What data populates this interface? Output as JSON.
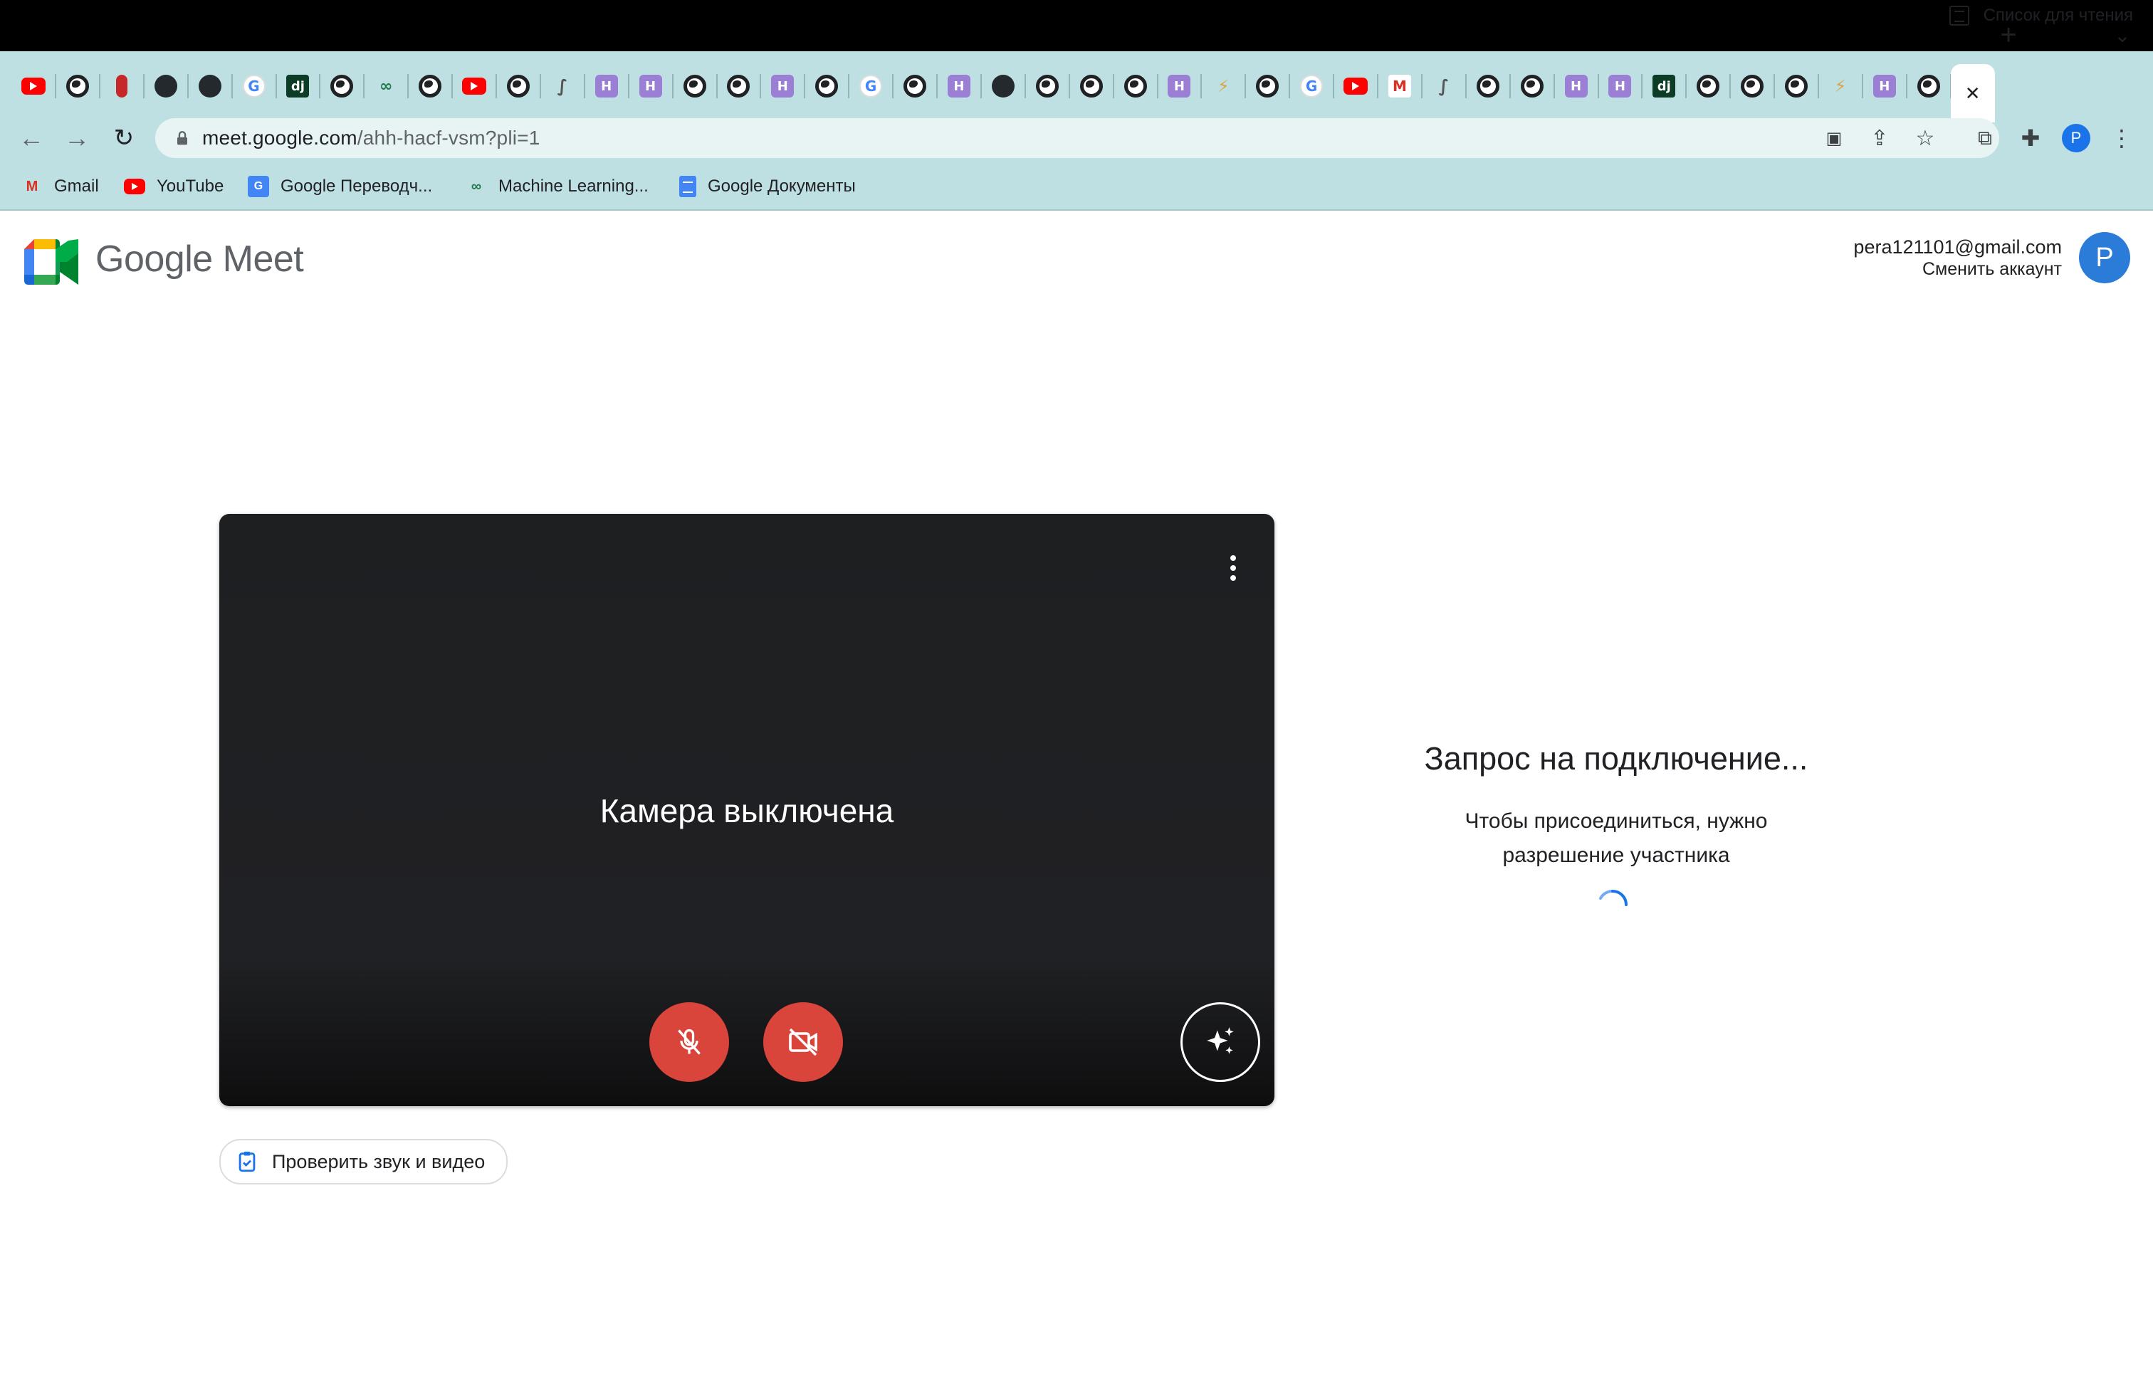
{
  "browser": {
    "tabs": [
      {
        "icon": "youtube-icon",
        "kind": "yt"
      },
      {
        "icon": "globe-icon",
        "kind": "globe"
      },
      {
        "icon": "red-dot-icon",
        "kind": "dot"
      },
      {
        "icon": "github-icon",
        "kind": "gh"
      },
      {
        "icon": "github-icon",
        "kind": "gh"
      },
      {
        "icon": "google-icon",
        "kind": "goog"
      },
      {
        "icon": "django-icon",
        "kind": "dj"
      },
      {
        "icon": "globe-icon",
        "kind": "globe"
      },
      {
        "icon": "machine-learning-icon",
        "kind": "ml"
      },
      {
        "icon": "globe-icon",
        "kind": "globe"
      },
      {
        "icon": "youtube-icon",
        "kind": "yt"
      },
      {
        "icon": "globe-icon",
        "kind": "globe"
      },
      {
        "icon": "flask-icon",
        "kind": "fl"
      },
      {
        "icon": "hexlet-icon",
        "kind": "hx"
      },
      {
        "icon": "hexlet-icon",
        "kind": "hx"
      },
      {
        "icon": "globe-icon",
        "kind": "globe"
      },
      {
        "icon": "globe-icon",
        "kind": "globe"
      },
      {
        "icon": "hexlet-icon",
        "kind": "hx"
      },
      {
        "icon": "globe-icon",
        "kind": "globe"
      },
      {
        "icon": "google-icon",
        "kind": "goog"
      },
      {
        "icon": "globe-icon",
        "kind": "globe"
      },
      {
        "icon": "hexlet-icon",
        "kind": "hx"
      },
      {
        "icon": "github-icon",
        "kind": "gh"
      },
      {
        "icon": "globe-icon",
        "kind": "globe"
      },
      {
        "icon": "globe-icon",
        "kind": "globe"
      },
      {
        "icon": "globe-icon",
        "kind": "globe"
      },
      {
        "icon": "hexlet-icon",
        "kind": "hx"
      },
      {
        "icon": "yellow-icon",
        "kind": "yl"
      },
      {
        "icon": "globe-icon",
        "kind": "globe"
      },
      {
        "icon": "google-icon",
        "kind": "goog"
      },
      {
        "icon": "youtube-icon",
        "kind": "yt"
      },
      {
        "icon": "gmail-icon",
        "kind": "gm"
      },
      {
        "icon": "flask-icon",
        "kind": "fl"
      },
      {
        "icon": "globe-icon",
        "kind": "globe"
      },
      {
        "icon": "globe-icon",
        "kind": "globe"
      },
      {
        "icon": "hexlet-icon",
        "kind": "hx"
      },
      {
        "icon": "hexlet-icon",
        "kind": "hx"
      },
      {
        "icon": "django-icon",
        "kind": "dj"
      },
      {
        "icon": "globe-icon",
        "kind": "globe"
      },
      {
        "icon": "globe-icon",
        "kind": "globe"
      },
      {
        "icon": "globe-icon",
        "kind": "globe"
      },
      {
        "icon": "yellow-icon",
        "kind": "yl"
      },
      {
        "icon": "hexlet-icon",
        "kind": "hx"
      },
      {
        "icon": "globe-icon",
        "kind": "globe"
      },
      {
        "icon": "close-icon",
        "kind": "close",
        "active": true
      }
    ],
    "url_host": "meet.google.com",
    "url_path": "/ahh-hacf-vsm?pli=1",
    "profile_initial": "P",
    "bookmarks": [
      {
        "label": "Gmail",
        "icon": "gmail-icon"
      },
      {
        "label": "YouTube",
        "icon": "youtube-icon"
      },
      {
        "label": "Google Переводч...",
        "icon": "google-translate-icon"
      },
      {
        "label": "Machine Learning...",
        "icon": "machine-learning-icon"
      },
      {
        "label": "Google Документы",
        "icon": "google-docs-icon"
      }
    ],
    "reading_list": "Список для чтения"
  },
  "meet": {
    "logo_text_google": "Google",
    "logo_text_meet": "Meet",
    "account_email": "pera121101@gmail.com",
    "switch_account": "Сменить аккаунт",
    "avatar_initial": "P",
    "camera_off_text": "Камера выключена",
    "check_av_label": "Проверить звук и видео",
    "join_title": "Запрос на подключение...",
    "join_desc_line1": "Чтобы присоединиться, нужно",
    "join_desc_line2": "разрешение участника"
  },
  "colors": {
    "chrome_bg": "#bfe0e2",
    "mic_cam_off": "#d9453a",
    "avatar": "#2b7bd8",
    "spinner": "#1a73e8"
  }
}
